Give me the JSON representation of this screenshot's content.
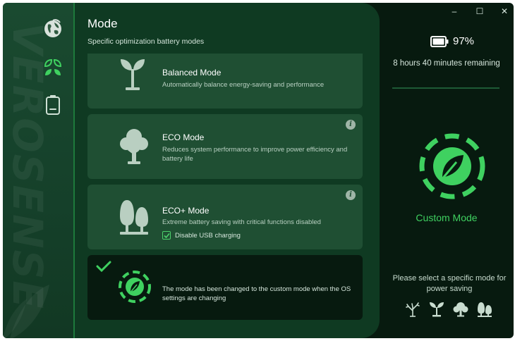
{
  "window": {
    "controls": {
      "minimize": "–",
      "maximize": "☐",
      "close": "✕"
    }
  },
  "sidebar": {
    "brand_watermark": "VEROSENSE",
    "items": [
      {
        "icon": "globe-icon"
      },
      {
        "icon": "leaf-mode-icon"
      },
      {
        "icon": "battery-icon"
      }
    ]
  },
  "main": {
    "title": "Mode",
    "subtitle": "Specific optimization battery modes",
    "cards": [
      {
        "title": "Balanced Mode",
        "description": "Automatically balance energy-saving and performance",
        "icon": "sprout-icon"
      },
      {
        "title": "ECO Mode",
        "description": "Reduces system performance to improve power efficiency and battery life",
        "icon": "tree-icon",
        "info": "i"
      },
      {
        "title": "ECO+ Mode",
        "description": "Extreme battery saving with critical functions disabled",
        "icon": "forest-icon",
        "info": "i",
        "checkbox": {
          "label": "Disable USB charging",
          "checked": true
        }
      },
      {
        "description": "The mode has been changed to the custom mode when the OS settings are changing",
        "icon": "custom-leaf-icon",
        "selected": true
      }
    ]
  },
  "status": {
    "battery_percent": "97%",
    "battery_level": 0.97,
    "remaining": "8 hours 40 minutes remaining",
    "current_mode": "Custom Mode",
    "hint": "Please select a specific mode for power saving"
  },
  "colors": {
    "accent_green": "#3fd160",
    "panel_bg": "#0f3a22",
    "card_bg": "#1f4f33",
    "dark_bg": "#071a0f"
  }
}
